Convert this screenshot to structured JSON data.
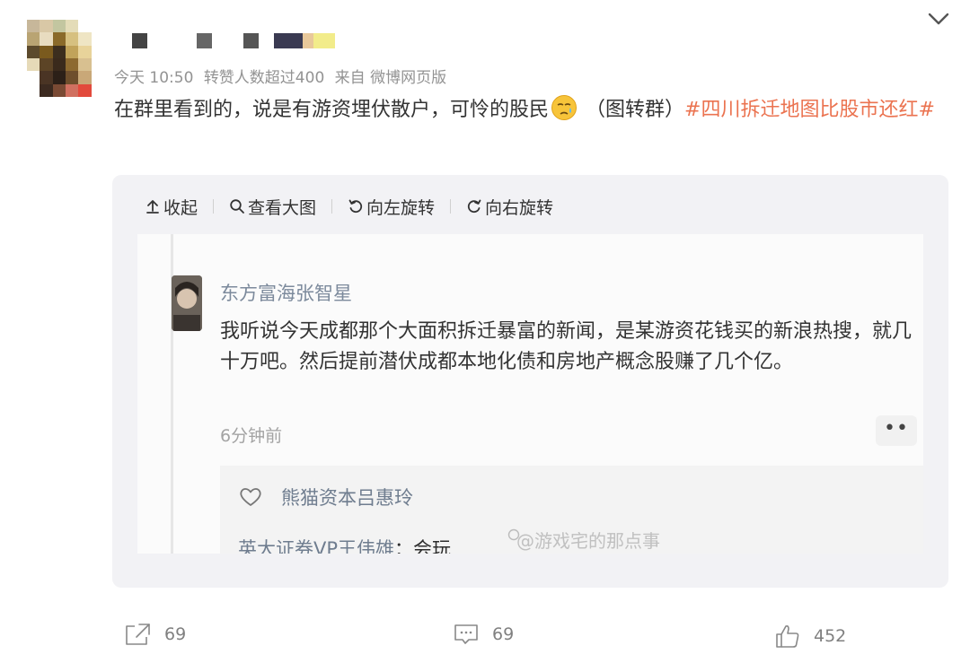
{
  "post": {
    "meta": {
      "time": "今天 10:50",
      "repost_note": "转赞人数超过400",
      "source": "来自 微博网页版"
    },
    "text": "在群里看到的，说是有游资埋伏散户，可怜的股民",
    "text_after_emoji": " （图转群）",
    "hashtag": "#四川拆迁地图比股市还红#"
  },
  "media_toolbar": {
    "collapse": "收起",
    "view_large": "查看大图",
    "rotate_left": "向左旋转",
    "rotate_right": "向右旋转"
  },
  "image": {
    "comment": {
      "username": "东方富海张智星",
      "body": "我听说今天成都那个大面积拆迁暴富的新闻，是某游资花钱买的新浪热搜，就几十万吧。然后提前潜伏成都本地化债和房地产概念股赚了几个亿。",
      "time": "6分钟前",
      "more": "••"
    },
    "reply": {
      "username": "熊猫资本吕惠玲",
      "author": "英大证券VP王伟雄",
      "text": "：会玩",
      "watermark": "@游戏宅的那点事"
    }
  },
  "actions": {
    "share_count": "69",
    "comment_count": "69",
    "like_count": "452"
  },
  "colors": {
    "hashtag": "#eb7350",
    "meta_gray": "#939393",
    "panel_bg": "#f2f2f5"
  }
}
